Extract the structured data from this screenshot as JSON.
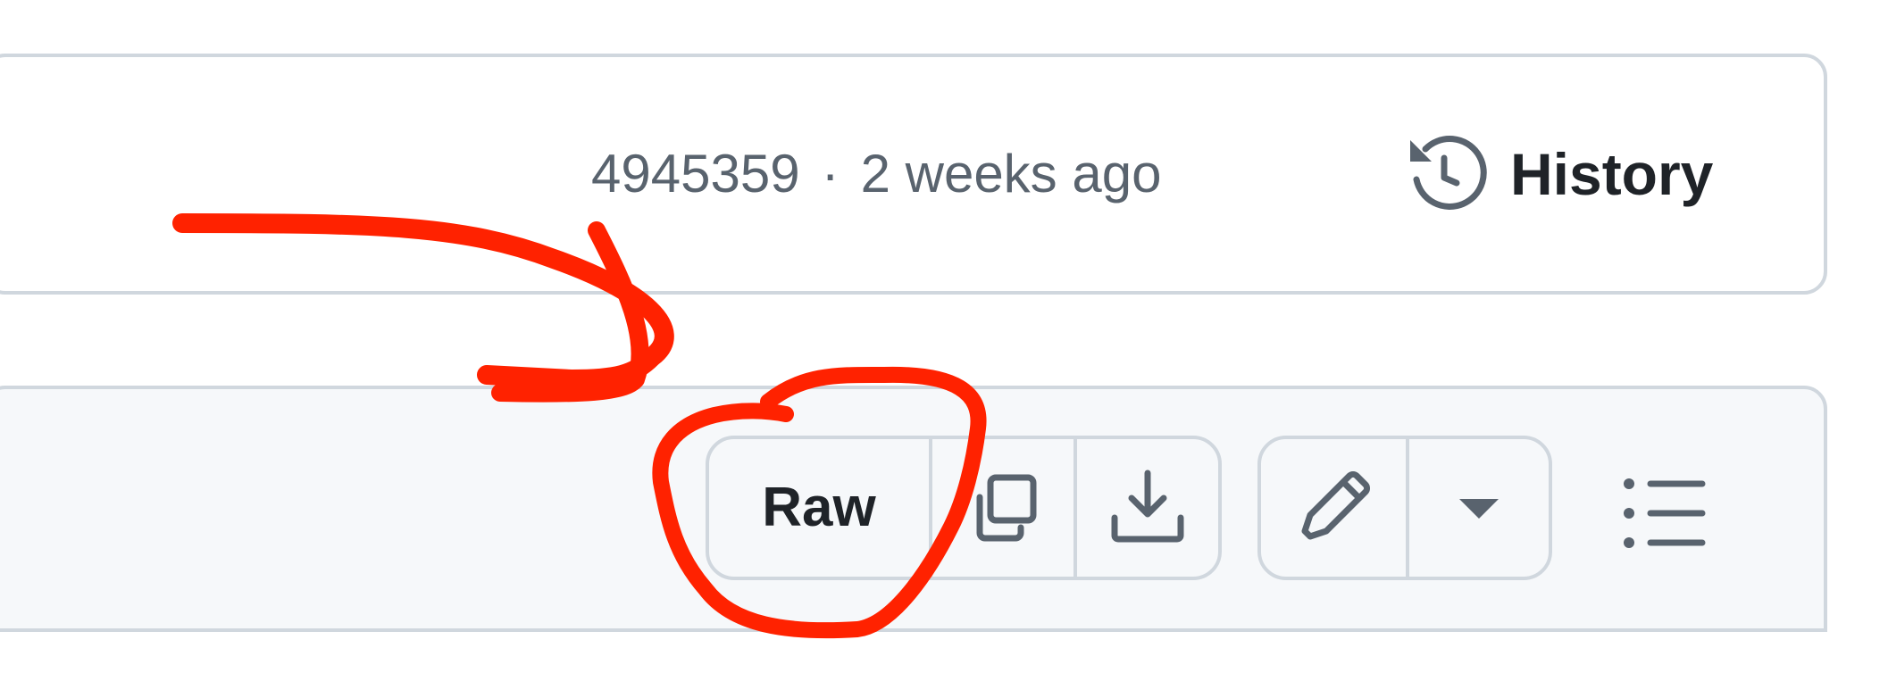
{
  "commit": {
    "hash": "4945359",
    "separator": "·",
    "time": "2 weeks ago"
  },
  "history": {
    "label": "History",
    "icon": "history-icon"
  },
  "toolbar": {
    "raw_label": "Raw",
    "copy_icon": "copy-icon",
    "download_icon": "download-icon",
    "edit_icon": "pencil-icon",
    "more_icon": "triangle-down-icon",
    "outline_icon": "list-unordered-icon"
  },
  "colors": {
    "text_primary": "#1f2328",
    "text_muted": "#59636e",
    "border": "#d0d7de",
    "header_bg": "#f6f8fa",
    "annotation": "#ff2200"
  }
}
